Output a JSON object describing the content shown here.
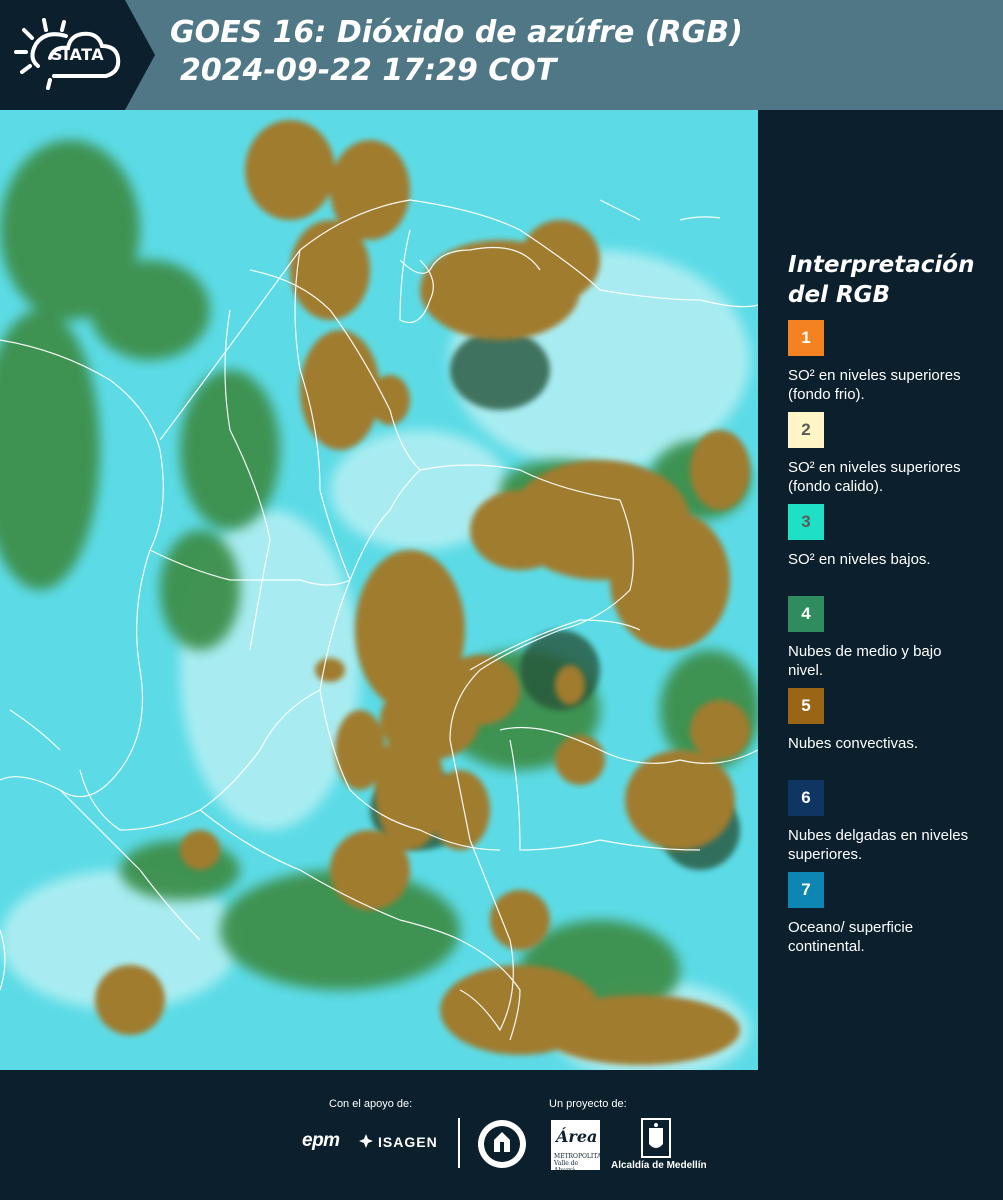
{
  "header": {
    "logo": "SIATA",
    "title_line1": "GOES 16: Dióxido de azúfre (RGB)",
    "title_line2": "2024-09-22 17:29 COT"
  },
  "map": {
    "background_color": "#5cdbe6",
    "convective_cloud_color": "#a07b2e",
    "low_cloud_color": "#3a8a4a",
    "boundary_color": "#ffffff"
  },
  "legend": {
    "title_line1": "Interpretación",
    "title_line2": "del RGB",
    "items": [
      {
        "number": "1",
        "color": "#f58220",
        "text": "SO² en niveles superiores (fondo frio)."
      },
      {
        "number": "2",
        "color": "#fff5c6",
        "text": "SO² en niveles superiores (fondo calido)."
      },
      {
        "number": "3",
        "color": "#1ee0c4",
        "text": "SO² en niveles bajos."
      },
      {
        "number": "4",
        "color": "#2f8c5e",
        "text": "Nubes de medio y bajo nivel."
      },
      {
        "number": "5",
        "color": "#9a6514",
        "text": "Nubes convectivas."
      },
      {
        "number": "6",
        "color": "#0f3663",
        "text": "Nubes delgadas en niveles superiores."
      },
      {
        "number": "7",
        "color": "#0d86b3",
        "text": "Oceano/ superficie continental."
      }
    ]
  },
  "footer": {
    "support_label": "Con el apoyo de:",
    "project_label": "Un proyecto de:",
    "sponsor1": "epm",
    "sponsor2": "ISAGEN",
    "area_word": "Área",
    "area_sub": "METROPOLITANA Valle de Aburrá",
    "alcaldia": "Alcaldía de Medellín"
  }
}
